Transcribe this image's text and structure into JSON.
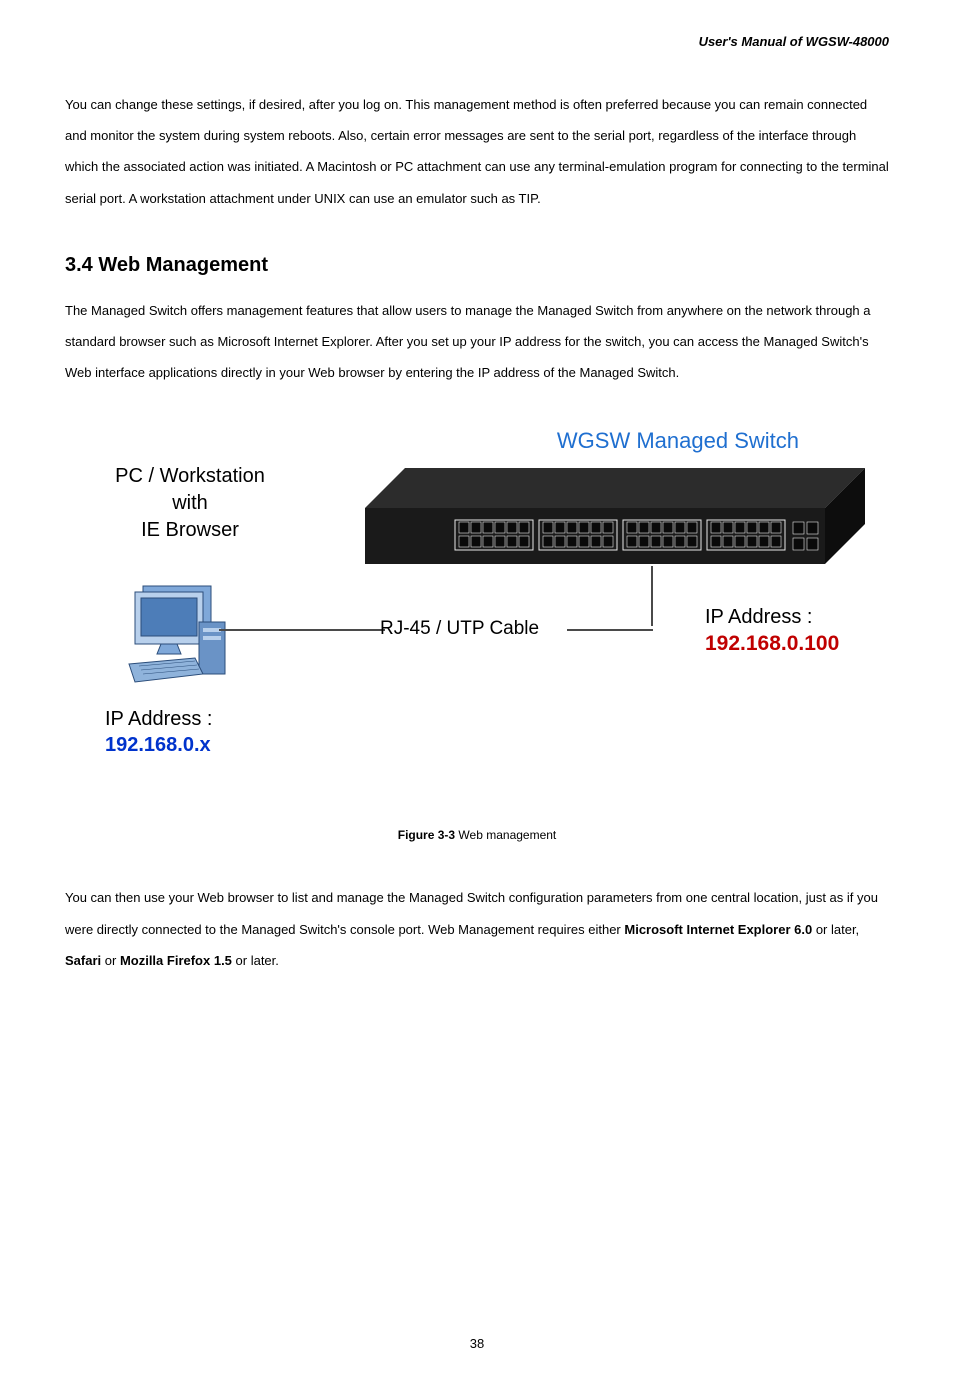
{
  "header": {
    "manual_title": "User's Manual of WGSW-48000"
  },
  "paragraph1": "You can change these settings, if desired, after you log on. This management method is often preferred because you can remain connected and monitor the system during system reboots. Also, certain error messages are sent to the serial port, regardless of the interface through which the associated action was initiated. A Macintosh or PC attachment can use any terminal-emulation program for connecting to the terminal serial port. A workstation attachment under UNIX can use an emulator such as TIP.",
  "section_heading": "3.4 Web Management",
  "paragraph2": "The Managed Switch offers management features that allow users to manage the Managed Switch from anywhere on the network through a standard browser such as Microsoft Internet Explorer. After you set up your IP address for the switch, you can access the Managed Switch's Web interface applications directly in your Web browser by entering the IP address of the Managed Switch.",
  "figure": {
    "switch_title": "WGSW Managed Switch",
    "pc_line1": "PC / Workstation",
    "pc_line2": "with",
    "pc_line3": "IE Browser",
    "pc_ip_label": "IP Address :",
    "pc_ip_value": "192.168.0.x",
    "switch_ip_label": "IP Address :",
    "switch_ip_value": "192.168.0.100",
    "cable_label": "RJ-45 / UTP Cable",
    "caption_bold": "Figure 3-3",
    "caption_rest": " Web management"
  },
  "paragraph3_part1": "You can then use your Web browser to list and manage the Managed Switch configuration parameters from one central location, just as if you were directly connected to the Managed Switch's console port. Web Management requires either ",
  "paragraph3_bold1": "Microsoft Internet Explorer 6.0",
  "paragraph3_part2": " or later, ",
  "paragraph3_bold2": "Safari",
  "paragraph3_part3": " or ",
  "paragraph3_bold3": "Mozilla Firefox 1.5",
  "paragraph3_part4": " or later.",
  "page_number": "38"
}
